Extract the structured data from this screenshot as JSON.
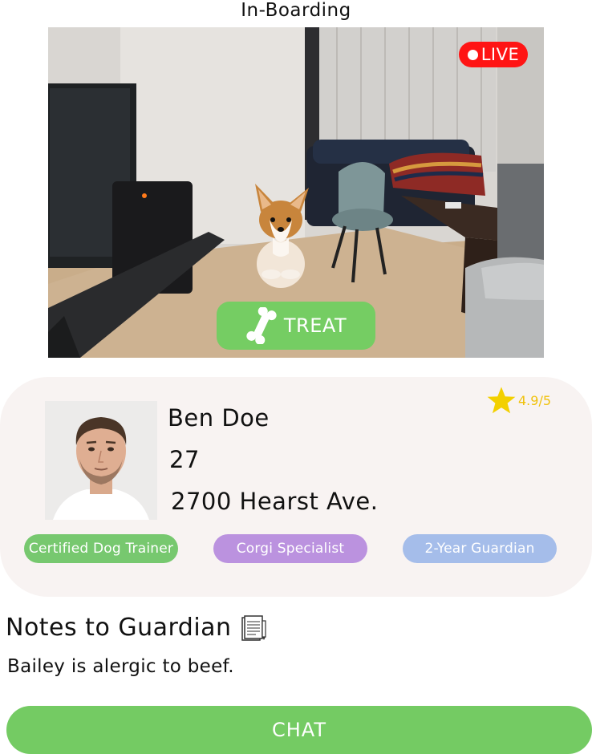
{
  "header": {
    "title": "In-Boarding"
  },
  "video": {
    "live_label": "LIVE",
    "treat_label": "TREAT",
    "treat_icon": "bone-icon"
  },
  "guardian": {
    "name": "Ben Doe",
    "age": "27",
    "address": "2700 Hearst Ave.",
    "rating": "4.9/5",
    "rating_icon": "star-icon",
    "rating_color": "#f0c10a",
    "tags": [
      {
        "label": "Certified Dog Trainer",
        "color": "#77c86f"
      },
      {
        "label": "Corgi Specialist",
        "color": "#bb92df"
      },
      {
        "label": "2-Year Guardian",
        "color": "#a5bdea"
      }
    ]
  },
  "notes": {
    "heading": "Notes to Guardian",
    "heading_icon": "notepad-icon",
    "body": "Bailey is alergic to beef."
  },
  "actions": {
    "chat_label": "CHAT"
  },
  "colors": {
    "live": "#ff1414",
    "primary_green": "#74cb63",
    "card_background": "#f8f3f2"
  }
}
